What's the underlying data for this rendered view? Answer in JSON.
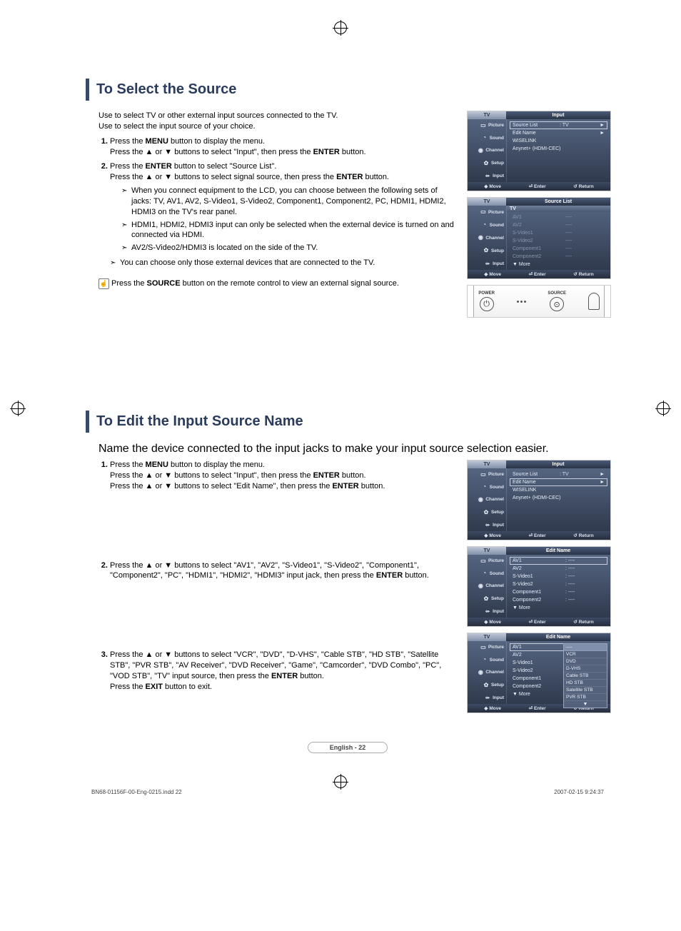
{
  "section1": {
    "title": "To Select the Source",
    "intro_line1": "Use to select TV or other external input sources connected to the TV.",
    "intro_line2": "Use to select the input source of your choice.",
    "step1_p1a": "Press the ",
    "step1_p1b": "MENU",
    "step1_p1c": " button to display the menu.",
    "step1_p2a": "Press  the ▲ or ▼ buttons to select \"Input\", then press the ",
    "step1_p2b": "ENTER",
    "step1_p2c": " button.",
    "step2_p1a": "Press the ",
    "step2_p1b": "ENTER",
    "step2_p1c": " button to select \"Source List\".",
    "step2_p2a": "Press the ▲ or ▼ buttons to select signal source, then press the ",
    "step2_p2b": "ENTER",
    "step2_p2c": " button.",
    "note1": "When you connect equipment to the LCD, you can choose between the following sets of jacks: TV, AV1, AV2, S-Video1, S-Video2, Component1, Component2, PC, HDMI1, HDMI2, HDMI3 on the TV's rear panel.",
    "note2": "HDMI1, HDMI2, HDMI3 input can only be selected when the external device is turned on and connected via HDMI.",
    "note3": " AV2/S-Video2/HDMI3 is located on the side of the TV.",
    "outer_note": "You can choose only those external devices that are connected to the TV.",
    "remote_note_a": "Press the ",
    "remote_note_b": "SOURCE",
    "remote_note_c": " button on the remote control to view an external signal source."
  },
  "section2": {
    "title": "To Edit the Input Source Name",
    "intro": "Name the device connected to the input jacks to make your input source selection easier.",
    "step1_p1a": "Press the ",
    "step1_p1b": "MENU",
    "step1_p1c": " button to display the menu.",
    "step1_p2a": "Press  the ▲ or ▼ buttons to select \"Input\", then press the ",
    "step1_p2b": "ENTER",
    "step1_p2c": " button.",
    "step1_p3a": "Press the ▲ or ▼ buttons to select \"Edit Name\", then press the ",
    "step1_p3b": "ENTER",
    "step1_p3c": " button.",
    "step2_p1a": "Press the ▲ or ▼ buttons to select \"AV1\", \"AV2\", \"S-Video1\", \"S-Video2\", \"Component1\", \"Component2\", \"PC\", \"HDMI1\", \"HDMI2\", \"HDMI3\" input jack, then press the ",
    "step2_p1b": "ENTER",
    "step2_p1c": " button.",
    "step3_p1a": "Press the ▲ or ▼ buttons to select \"VCR\", \"DVD\", \"D-VHS\", \"Cable STB\", \"HD STB\", \"Satellite STB\", \"PVR STB\", \"AV Receiver\", \"DVD Receiver\", \"Game\", \"Camcorder\", \"DVD Combo\", \"PC\", \"VOD STB\", \"TV\" input source, then press the ",
    "step3_p1b": "ENTER",
    "step3_p1c": " button.",
    "step3_p2a": "Press the ",
    "step3_p2b": "EXIT",
    "step3_p2c": " button to exit."
  },
  "osd": {
    "tv_label": "TV",
    "side": {
      "picture": "Picture",
      "sound": "Sound",
      "channel": "Channel",
      "setup": "Setup",
      "input": "Input"
    },
    "foot": {
      "move": "Move",
      "enter": "Enter",
      "return": "Return"
    },
    "fig1": {
      "title": "Input",
      "source_list": "Source List",
      "source_list_val": ": TV",
      "edit_name": "Edit Name",
      "wiselink": "WISELINK",
      "anynet": "Anynet+ (HDMI-CEC)",
      "arrow": "►"
    },
    "fig2": {
      "title": "Source List",
      "hdr": "TV",
      "items": [
        {
          "lbl": "AV1",
          "val": "----"
        },
        {
          "lbl": "AV2",
          "val": "----"
        },
        {
          "lbl": "S-Video1",
          "val": "----"
        },
        {
          "lbl": "S-Video2",
          "val": "----"
        },
        {
          "lbl": "Component1",
          "val": "----"
        },
        {
          "lbl": "Component2",
          "val": "----"
        }
      ],
      "more": "▼ More"
    },
    "fig_remote": {
      "power": "POWER",
      "source": "SOURCE"
    },
    "fig3": {
      "title": "Input",
      "source_list": "Source List",
      "source_list_val": ": TV",
      "edit_name": "Edit Name",
      "wiselink": "WISELINK",
      "anynet": "Anynet+ (HDMI-CEC)",
      "arrow": "►"
    },
    "fig4": {
      "title": "Edit Name",
      "items": [
        {
          "lbl": "AV1",
          "val": ": ----",
          "boxed": true
        },
        {
          "lbl": "AV2",
          "val": ": ----"
        },
        {
          "lbl": "S-Video1",
          "val": ": ----"
        },
        {
          "lbl": "S-Video2",
          "val": ": ----"
        },
        {
          "lbl": "Component1",
          "val": ": ----"
        },
        {
          "lbl": "Component2",
          "val": ": ----"
        }
      ],
      "more": "▼ More"
    },
    "fig5": {
      "title": "Edit Name",
      "items": [
        {
          "lbl": "AV1",
          "val": ""
        },
        {
          "lbl": "AV2",
          "val": ""
        },
        {
          "lbl": "S-Video1",
          "val": ""
        },
        {
          "lbl": "S-Video2",
          "val": ""
        },
        {
          "lbl": "Component1",
          "val": ":"
        },
        {
          "lbl": "Component2",
          "val": ""
        }
      ],
      "more": "▼ More",
      "dropdown": [
        "----",
        "VCR",
        "DVD",
        "D-VHS",
        "Cable STB",
        "HD STB",
        "Satellite STB",
        "PVR STB"
      ],
      "dd_more": "▼"
    }
  },
  "footer": {
    "pill": "English - 22",
    "file": "BN68-01156F-00-Eng-0215.indd   22",
    "stamp": "2007-02-15     9:24:37"
  }
}
